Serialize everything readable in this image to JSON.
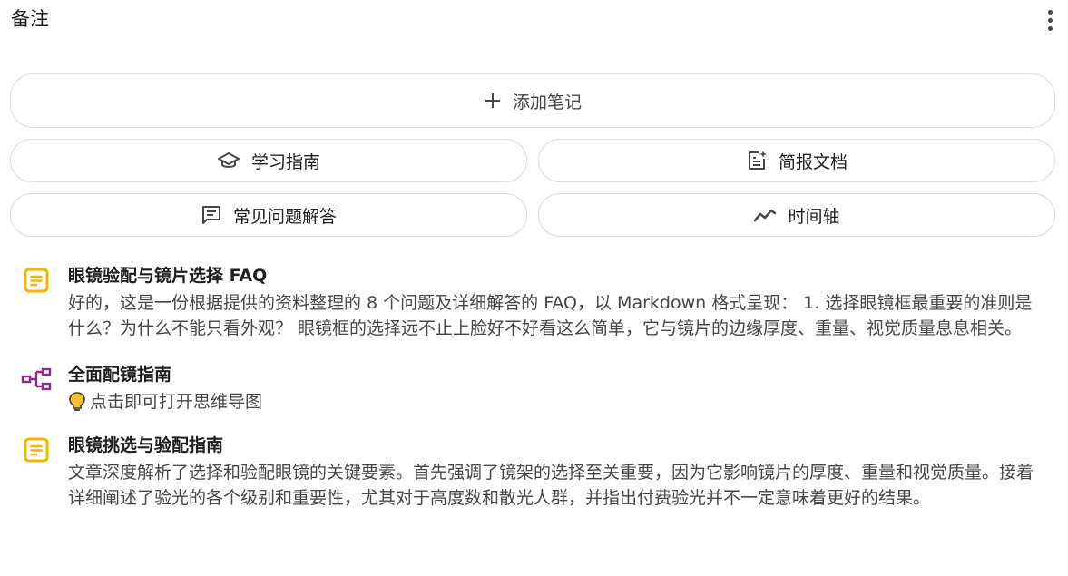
{
  "header": {
    "title": "备注",
    "more_icon": "more-vert-icon"
  },
  "actions": {
    "add_note": {
      "label": "添加笔记",
      "icon": "plus-icon"
    },
    "study_guide": {
      "label": "学习指南",
      "icon": "graduation-cap-icon"
    },
    "briefing_doc": {
      "label": "简报文档",
      "icon": "doc-sparkle-icon"
    },
    "faq": {
      "label": "常见问题解答",
      "icon": "chat-lines-icon"
    },
    "timeline": {
      "label": "时间轴",
      "icon": "trend-line-icon"
    }
  },
  "notes": [
    {
      "icon": "note-doc-icon",
      "title": "眼镜验配与镜片选择 FAQ",
      "body": "好的，这是一份根据提供的资料整理的 8 个问题及详细解答的 FAQ，以 Markdown 格式呈现： 1. 选择眼镜框最重要的准则是什么？为什么不能只看外观？ 眼镜框的选择远不止上脸好不好看这么简单，它与镜片的边缘厚度、重量、视觉质量息息相关。"
    },
    {
      "icon": "mind-map-icon",
      "title": "全面配镜指南",
      "hint": "点击即可打开思维导图",
      "hint_icon": "lightbulb-icon"
    },
    {
      "icon": "note-doc-icon",
      "title": "眼镜挑选与验配指南",
      "body": "文章深度解析了选择和验配眼镜的关键要素。首先强调了镜架的选择至关重要，因为它影响镜片的厚度、重量和视觉质量。接着详细阐述了验光的各个级别和重要性，尤其对于高度数和散光人群，并指出付费验光并不一定意味着更好的结果。"
    }
  ],
  "colors": {
    "note_icon": "#f4b400",
    "mind_map_icon": "#8e2a8e",
    "hint_icon": "#f4b400",
    "border": "#dadce0"
  }
}
